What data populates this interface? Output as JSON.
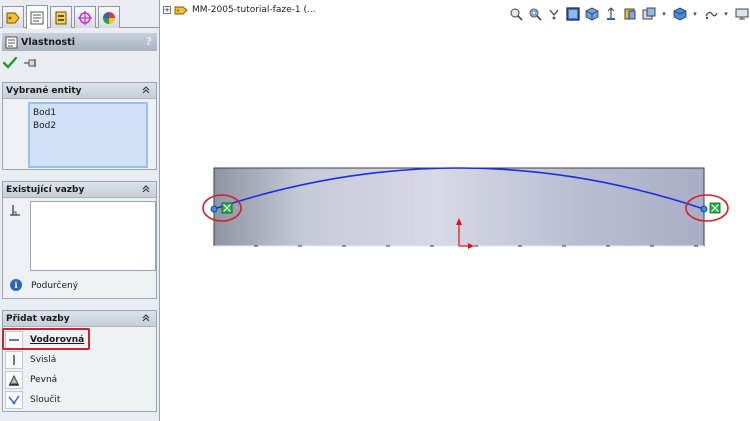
{
  "property_manager": {
    "title": "Vlastnosti",
    "help": "?",
    "ok_icon": "checkmark-icon",
    "pin_icon": "pushpin-icon"
  },
  "selected_entities": {
    "title": "Vybrané entity",
    "items": [
      "Bod1",
      "Bod2"
    ]
  },
  "existing_relations": {
    "title": "Existující vazby",
    "status": "Podurčený"
  },
  "add_relations": {
    "title": "Přidat vazby",
    "items": [
      {
        "label": "Vodorovná",
        "icon": "horizontal-relation-icon"
      },
      {
        "label": "Svislá",
        "icon": "vertical-relation-icon"
      },
      {
        "label": "Pevná",
        "icon": "fix-relation-icon"
      },
      {
        "label": "Sloučit",
        "icon": "merge-relation-icon"
      }
    ]
  },
  "feature_tree": {
    "expander": "+",
    "part_name": "MM-2005-tutorial-faze-1  (..."
  },
  "colors": {
    "accent_blue": "#1a2fe0",
    "highlight_red": "#d0202a",
    "selection_blue": "#cfe2f6"
  }
}
